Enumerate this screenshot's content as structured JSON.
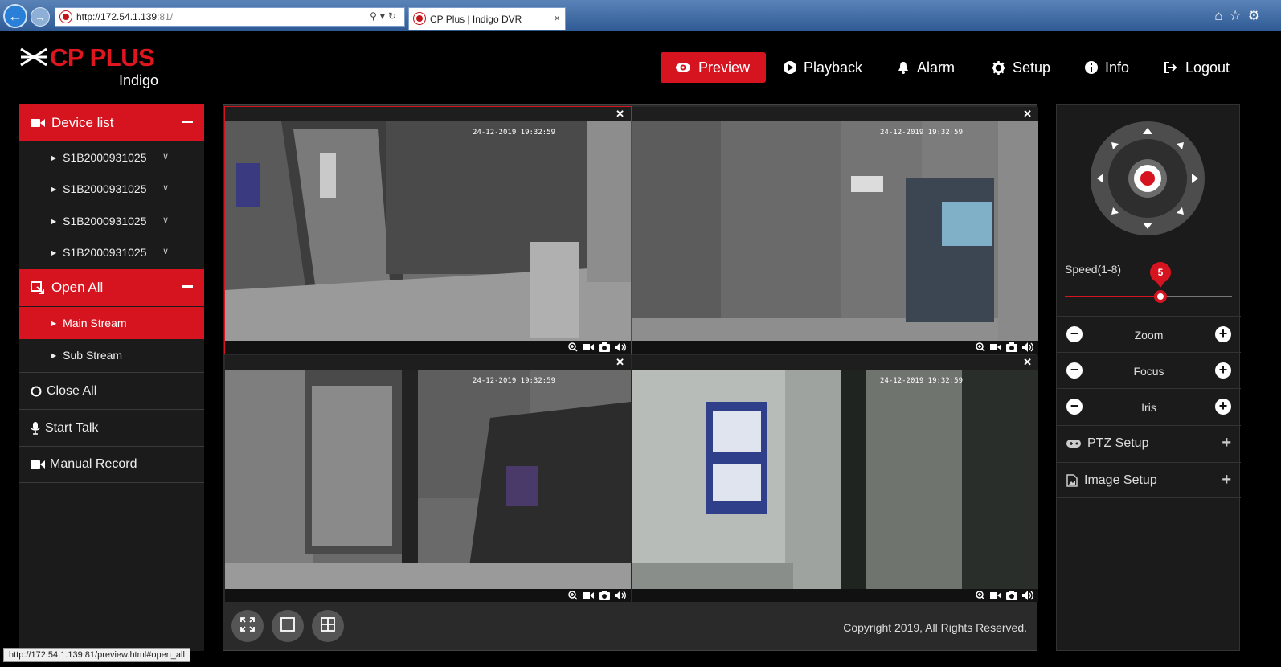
{
  "browser": {
    "url_host": "http://172.54.1.139",
    "url_port": ":81/",
    "tab_title": "CP Plus | Indigo DVR",
    "tab_close": "×"
  },
  "brand": {
    "name": "CP PLUS",
    "product": "Indigo",
    "accent": "#d6141f"
  },
  "nav": {
    "preview": "Preview",
    "playback": "Playback",
    "alarm": "Alarm",
    "setup": "Setup",
    "info": "Info",
    "logout": "Logout"
  },
  "sidebar": {
    "device_list": "Device list",
    "devices": [
      "S1B2000931025",
      "S1B2000931025",
      "S1B2000931025",
      "S1B2000931025"
    ],
    "open_all": "Open All",
    "main_stream": "Main Stream",
    "sub_stream": "Sub Stream",
    "close_all": "Close All",
    "start_talk": "Start Talk",
    "manual_record": "Manual Record"
  },
  "cameras": [
    {
      "timestamp": "24-12-2019 19:32:59",
      "selected": true
    },
    {
      "timestamp": "24-12-2019 19:32:59",
      "selected": false
    },
    {
      "timestamp": "24-12-2019 19:32:59",
      "selected": false
    },
    {
      "timestamp": "24-12-2019 19:32:59",
      "selected": false
    }
  ],
  "footer": {
    "copyright": "Copyright 2019, All Rights Reserved."
  },
  "ptz": {
    "speed_label": "Speed(1-8)",
    "speed_value": "5",
    "speed_fraction": 0.57,
    "zoom": "Zoom",
    "focus": "Focus",
    "iris": "Iris",
    "ptz_setup": "PTZ Setup",
    "image_setup": "Image Setup"
  },
  "statusbar": {
    "text": "http://172.54.1.139:81/preview.html#open_all"
  }
}
